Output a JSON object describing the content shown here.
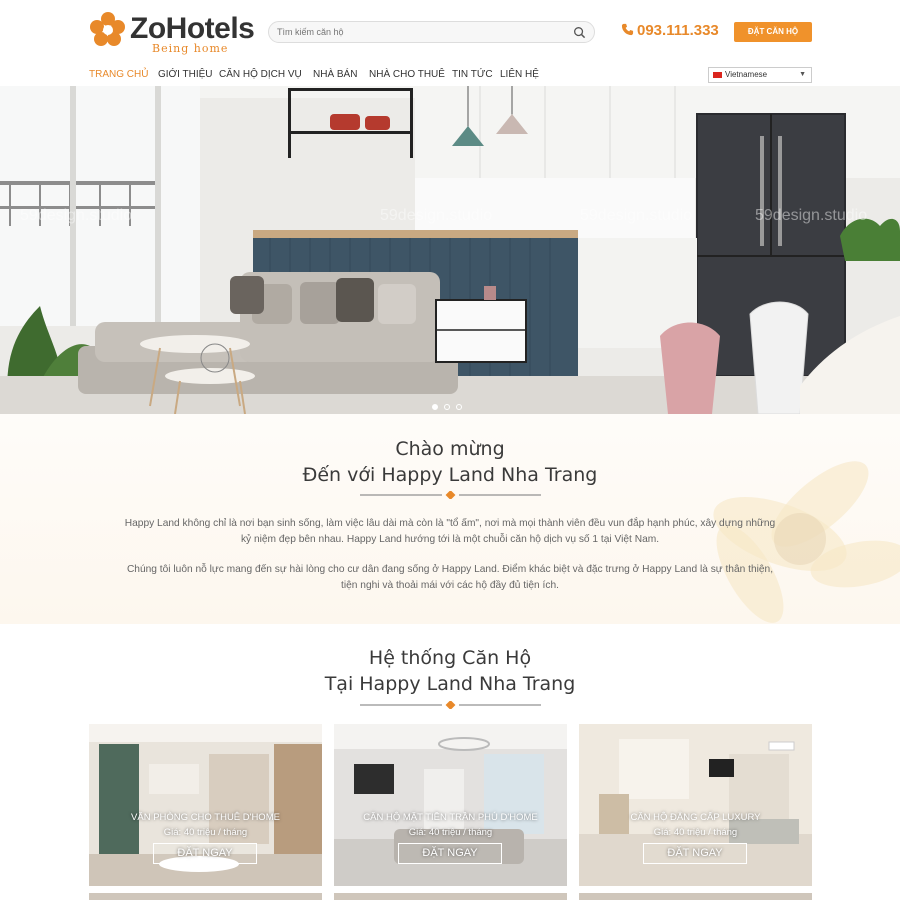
{
  "header": {
    "logo_text": "ZoHotels",
    "logo_tagline": "Being home",
    "search_placeholder": "Tìm kiếm căn hộ",
    "phone": "093.111.333",
    "book_button": "ĐẶT CĂN HỘ"
  },
  "nav": {
    "items": [
      {
        "label": "TRANG CHỦ"
      },
      {
        "label": "GIỚI THIỆU"
      },
      {
        "label": "CĂN HỘ DỊCH VỤ"
      },
      {
        "label": "NHÀ BÁN"
      },
      {
        "label": "NHÀ CHO THUÊ"
      },
      {
        "label": "TIN TỨC"
      },
      {
        "label": "LIÊN HỆ"
      }
    ],
    "language": "Vietnamese",
    "active_index": 0
  },
  "hero": {
    "watermark": "59design.studio",
    "slide_count": 3,
    "active_slide": 1
  },
  "welcome": {
    "title_line1": "Chào mừng",
    "title_line2": "Đến với Happy Land Nha Trang",
    "para1_line1": "Happy Land không chỉ là nơi bạn sinh sống, làm việc lâu dài mà còn là \"tổ ấm\", nơi mà mọi thành viên đều vun đắp hạnh phúc, xây dựng những",
    "para1_line2": "kỷ niệm đẹp bên nhau. Happy Land hướng tới là một chuỗi căn hộ dịch vụ số 1 tại Việt Nam.",
    "para2_line1": "Chúng tôi luôn nỗ lực mang đến sự hài lòng cho cư dân đang sống ở Happy Land. Điểm khác biệt và đặc trưng ở Happy Land là sự thân thiện,",
    "para2_line2": "tiện nghi và thoải mái với các hộ đầy đủ tiện ích."
  },
  "apartments": {
    "title_line1": "Hệ thống Căn Hộ",
    "title_line2": "Tại Happy Land Nha Trang",
    "cards": [
      {
        "title": "VĂN PHÒNG CHO THUÊ D'HOME",
        "price": "Giá: 40 triệu / tháng",
        "button": "ĐẶT NGAY"
      },
      {
        "title": "CĂN HỘ MẶT TIỀN TRẦN PHÚ D'HOME",
        "price": "Giá: 40 triệu / tháng",
        "button": "ĐẶT NGAY"
      },
      {
        "title": "CĂN HỘ ĐẲNG CẤP LUXURY",
        "price": "Giá: 40 triệu / tháng",
        "button": "ĐẶT NGAY"
      }
    ]
  },
  "colors": {
    "accent": "#e8892a",
    "button": "#f0922b",
    "text": "#333333"
  }
}
